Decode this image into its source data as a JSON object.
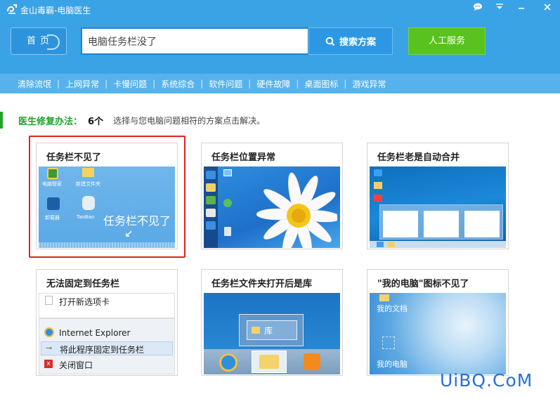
{
  "app": {
    "title": "金山毒霸-电脑医生"
  },
  "toolbar": {
    "home_label": "首页",
    "search_value": "电脑任务栏没了",
    "search_button_label": "搜索方案",
    "service_button_label": "人工服务"
  },
  "nav": {
    "items": [
      "清除流氓",
      "上网异常",
      "卡慢问题",
      "系统综合",
      "软件问题",
      "硬件故障",
      "桌面图标",
      "游戏异常"
    ]
  },
  "intro": {
    "label": "医生修复办法：",
    "count": "6个",
    "text": "选择与您电脑问题相符的方案点击解决。"
  },
  "cards": [
    {
      "title": "任务栏不见了",
      "thumb_text": "任务栏不见了",
      "icons": [
        "电脑管家",
        "新建文件夹",
        "卸载器",
        "TaoBao"
      ]
    },
    {
      "title": "任务栏位置异常"
    },
    {
      "title": "任务栏老是自动合并"
    },
    {
      "title": "无法固定到任务栏",
      "menu": [
        "打开新选项卡",
        "Internet Explorer",
        "将此程序固定到任务栏",
        "关闭窗口"
      ]
    },
    {
      "title": "任务栏文件夹打开后是库",
      "popup_label": "库"
    },
    {
      "title": "\"我的电脑\"图标不见了",
      "icons": [
        "我的文档",
        "我的电脑"
      ]
    }
  ],
  "watermark": "UiBQ.CoM",
  "colors": {
    "header": "#3aa3e6",
    "nav": "#56b2ec",
    "service": "#58c21e",
    "accent_green": "#22a22a",
    "selected": "#e02222"
  }
}
